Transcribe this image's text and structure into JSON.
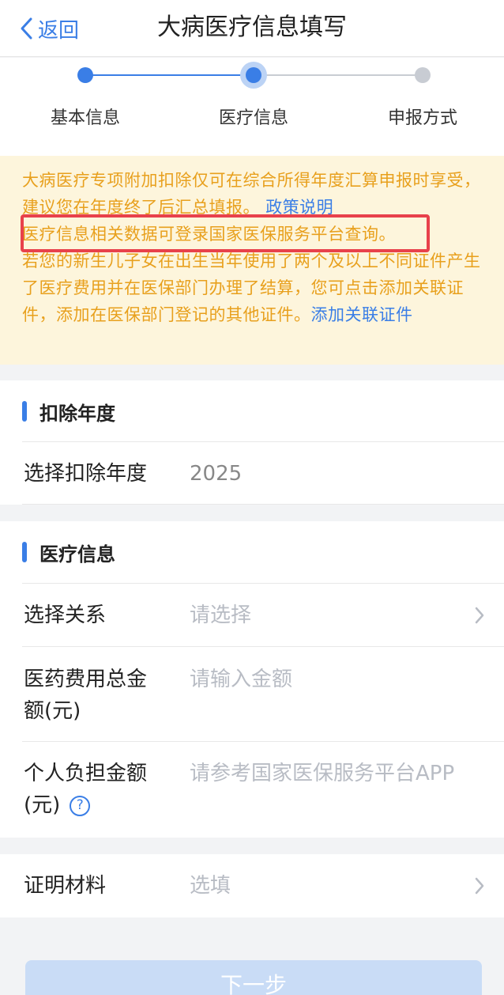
{
  "nav": {
    "back_label": "返回",
    "title": "大病医疗信息填写"
  },
  "steps": [
    {
      "label": "基本信息",
      "state": "done"
    },
    {
      "label": "医疗信息",
      "state": "current"
    },
    {
      "label": "申报方式",
      "state": "todo"
    }
  ],
  "notice": {
    "line1": "大病医疗专项附加扣除仅可在综合所得年度汇算申报时享受，建议您在年度终了后汇总填报。",
    "policy_link": "政策说明",
    "highlight": "医疗信息相关数据可登录国家医保服务平台查询。",
    "line3": "若您的新生儿子女在出生当年使用了两个及以上不同证件产生了医疗费用并在医保部门办理了结算，您可点击添加关联证件，添加在医保部门登记的其他证件。",
    "assoc_link": "添加关联证件"
  },
  "deduction": {
    "section_title": "扣除年度",
    "year_label": "选择扣除年度",
    "year_value": "2025"
  },
  "medical": {
    "section_title": "医疗信息",
    "relation_label": "选择关系",
    "relation_placeholder": "请选择",
    "total_label_1": "医药费用总金",
    "total_label_2": "额(元)",
    "total_placeholder": "请输入金额",
    "personal_label_1": "个人负担金额",
    "personal_label_2": "(元)",
    "personal_placeholder": "请参考国家医保服务平台APP"
  },
  "proof": {
    "label": "证明材料",
    "placeholder": "选填"
  },
  "footer": {
    "next_label": "下一步"
  },
  "colors": {
    "accent": "#3a7ee6",
    "notice_text": "#e8a01d",
    "notice_bg": "#fdf5dc",
    "highlight_border": "#e8414b"
  }
}
